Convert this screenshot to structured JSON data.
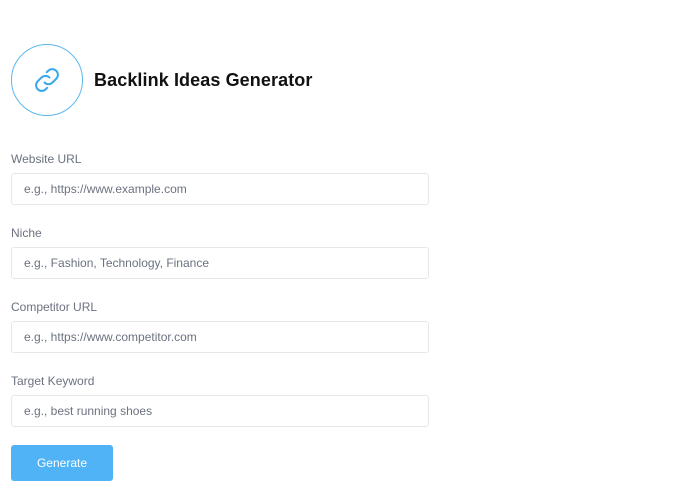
{
  "header": {
    "icon": "link-icon",
    "title": "Backlink Ideas Generator",
    "accent_color": "#4fb3f6"
  },
  "form": {
    "fields": [
      {
        "label": "Website URL",
        "value": "",
        "placeholder": "e.g., https://www.example.com"
      },
      {
        "label": "Niche",
        "value": "",
        "placeholder": "e.g., Fashion, Technology, Finance"
      },
      {
        "label": "Competitor URL",
        "value": "",
        "placeholder": "e.g., https://www.competitor.com"
      },
      {
        "label": "Target Keyword",
        "value": "",
        "placeholder": "e.g., best running shoes"
      }
    ],
    "submit_label": "Generate"
  }
}
